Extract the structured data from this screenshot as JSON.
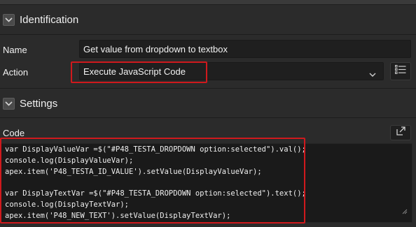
{
  "sections": {
    "identification": {
      "title": "Identification"
    },
    "settings": {
      "title": "Settings"
    }
  },
  "fields": {
    "name": {
      "label": "Name",
      "value": "Get value from dropdown to textbox"
    },
    "action": {
      "label": "Action",
      "value": "Execute JavaScript Code"
    },
    "code": {
      "label": "Code",
      "lines": [
        "var DisplayValueVar =$(\"#P48_TESTA_DROPDOWN option:selected\").val();",
        "console.log(DisplayValueVar);",
        "apex.item('P48_TESTA_ID_VALUE').setValue(DisplayValueVar);",
        "",
        "var DisplayTextVar =$(\"#P48_TESTA_DROPDOWN option:selected\").text();",
        "console.log(DisplayTextVar);",
        "apex.item('P48_NEW_TEXT').setValue(DisplayTextVar);"
      ]
    }
  },
  "icons": {
    "collapse": "chevron-down-icon",
    "list": "list-icon",
    "expand_editor": "expand-icon"
  },
  "colors": {
    "background": "#2b2b2b",
    "field": "#1f1f1f",
    "highlight": "#d0191d",
    "text": "#f2f2f2"
  }
}
